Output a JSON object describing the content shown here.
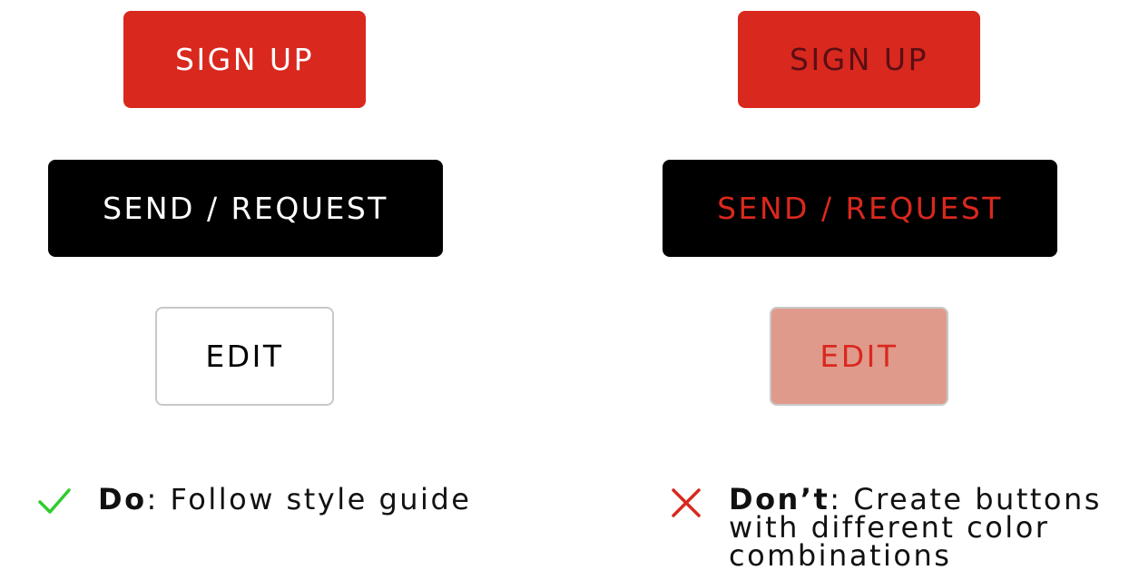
{
  "do_column": {
    "signup_label": "SIGN UP",
    "send_label": "SEND / REQUEST",
    "edit_label": "EDIT",
    "caption_bold": "Do",
    "caption_rest": ": Follow style guide"
  },
  "dont_column": {
    "signup_label": "SIGN UP",
    "send_label": "SEND / REQUEST",
    "edit_label": "EDIT",
    "caption_bold": "Don’t",
    "caption_rest": ": Create buttons with different color combinations"
  },
  "icons": {
    "do": "checkmark-icon",
    "dont": "x-icon"
  },
  "colors": {
    "brand_red": "#d9281e",
    "black": "#000000",
    "white": "#ffffff",
    "dark_red_text": "#5a0f14",
    "faded_red_bg": "#e09a8c",
    "border_gray": "#c8c8c8",
    "check_green": "#2ecc2e"
  }
}
